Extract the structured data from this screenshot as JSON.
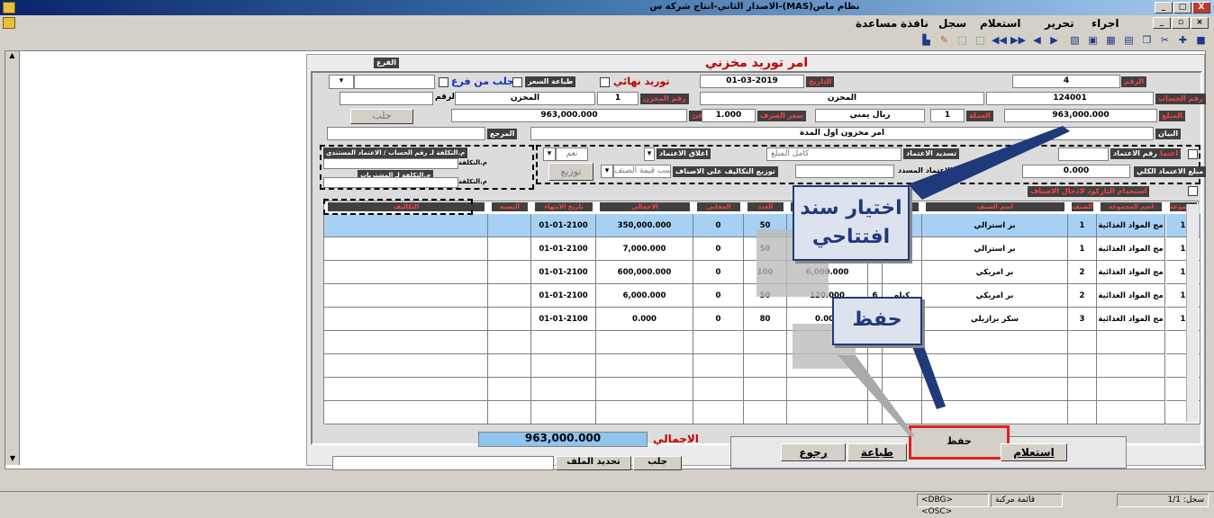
{
  "window": {
    "title": "نظام ماس(MAS)-الاصدار الثاني-انتاج شركة س",
    "min": "_",
    "max": "□",
    "close": "X"
  },
  "menu": [
    "اجراء",
    "تحرير",
    "استعلام",
    "سجل",
    "نافذة",
    "مساعدة"
  ],
  "form": {
    "title": "امر توريد مخزني",
    "branch_label": "الفرع",
    "fetch_from_branch": "جلب من فرع",
    "print_price": "طباعة السعر",
    "final_supply": "توريد نهائي",
    "date_label": "التاريخ",
    "date": "01-03-2019",
    "number_label": "الرقم",
    "number": "4",
    "account_label": "رقم الحساب",
    "account": "124001",
    "store_label": "المخزن",
    "store_num_label": "رقم المخزن",
    "store_num": "1",
    "store_name": "المخزن",
    "account_name": "المخزن",
    "number_label2": "الرقم",
    "amount_label": "المبلغ",
    "amount": "963,000.000",
    "currency_label": "العملة",
    "currency": "1",
    "currency_name": "ريال يمني",
    "rate_label": "سعر الصرف",
    "rate": "1.000",
    "equiv_label": "المكافئ",
    "equiv": "963,000.000",
    "statement_label": "البيان",
    "statement": "امر مخزون اول المدة",
    "ref_label": "المرجع",
    "fetch_btn": "جلب",
    "credit_label": "اعتماد",
    "credit_no_label": "رقم الاعتماد",
    "credit_total_label": "مبلغ الاعتماد الكلي",
    "credit_total": "0.000",
    "credit_paid_label": "الاعتماد المسدد",
    "pay_credit_label": "تسديد الاعتماد",
    "pay_credit_val": "كامل المبلغ",
    "close_credit_label": "اغلاق الاعتماد",
    "close_credit_val": "نعم",
    "dist_label": "توزيع التكاليف على الاصناف",
    "dist_val": "حسب قيمة الصنف",
    "dist_btn": "توزيع",
    "use_barcode": "استخدام الباركود لادخال الاصناف",
    "cost_acc_label": "م.التكلفة لـ رقم الحساب",
    "credit_acc_label": "الاعتماد المستندي",
    "cost_center": "م.التكلفة",
    "cost_purch": "م.التكلفة لـ المشتريات"
  },
  "grid": {
    "headers": [
      "المجموعة",
      "اسم المجموعة",
      "الصنف",
      "اسم الصنف",
      "الوحدة",
      "",
      "السعر",
      "العدد",
      "المجاني",
      "الاجمالي",
      "تاريخ الانتهاء",
      "النسبة",
      "التكاليف"
    ],
    "rows": [
      {
        "grp": "1",
        "grp_name": "مج المواد الغذائية",
        "item": "1",
        "item_name": "بر استرالي",
        "unit": "",
        "unit_no": "",
        "price": "7,000.000",
        "qty": "50",
        "free": "0",
        "total": "350,000.000",
        "expiry": "01-01-2100"
      },
      {
        "grp": "1",
        "grp_name": "مج المواد الغذائية",
        "item": "1",
        "item_name": "بر استرالي",
        "unit": "",
        "unit_no": "",
        "price": "140.000",
        "qty": "50",
        "free": "0",
        "total": "7,000.000",
        "expiry": "01-01-2100"
      },
      {
        "grp": "1",
        "grp_name": "مج المواد الغذائية",
        "item": "2",
        "item_name": "بر امريكي",
        "unit": "",
        "unit_no": "",
        "price": "6,000.000",
        "qty": "100",
        "free": "0",
        "total": "600,000.000",
        "expiry": "01-01-2100"
      },
      {
        "grp": "1",
        "grp_name": "مج المواد الغذائية",
        "item": "2",
        "item_name": "بر امريكي",
        "unit": "كيلو",
        "unit_no": "6",
        "price": "120.000",
        "qty": "50",
        "free": "0",
        "total": "6,000.000",
        "expiry": "01-01-2100"
      },
      {
        "grp": "1",
        "grp_name": "مج المواد الغذائية",
        "item": "3",
        "item_name": "سكر برازيلي",
        "unit": "",
        "unit_no": "",
        "price": "0.000",
        "qty": "80",
        "free": "0",
        "total": "0.000",
        "expiry": "01-01-2100"
      }
    ]
  },
  "footer": {
    "total_label": "الاجمالي",
    "total": "963,000.000",
    "fetch": "جلب",
    "select_file": "تحديد الملف",
    "query": "استعلام",
    "save": "حفظ",
    "print": "طباعة",
    "back": "رجوع"
  },
  "callouts": {
    "opening": "اختيار سند افتتاحي",
    "save": "حفظ"
  },
  "status": {
    "record": "سجل: 1/1",
    "mode": "قائمة مركبة",
    "keys": "<DBG> <OSC>"
  }
}
